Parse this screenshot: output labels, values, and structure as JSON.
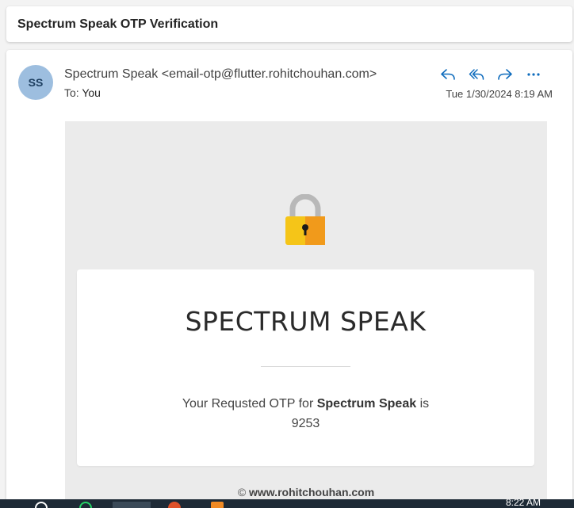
{
  "subject": "Spectrum Speak OTP Verification",
  "header": {
    "avatar_initials": "SS",
    "sender_display": "Spectrum Speak <email-otp@flutter.rohitchouhan.com>",
    "to_prefix": "To:",
    "to_name": "You",
    "date": "Tue 1/30/2024 8:19 AM",
    "actions": [
      "reply-icon",
      "reply-all-icon",
      "forward-icon",
      "more-icon"
    ]
  },
  "body": {
    "brand": "SPECTRUM SPEAK",
    "message_prefix": "Your Requsted OTP for",
    "message_brand": "Spectrum Speak",
    "message_suffix": "is",
    "otp_code": "9253",
    "footer_symbol": "©",
    "footer_site": "www.rohitchouhan.com"
  },
  "taskbar": {
    "clock": "8:22 AM"
  },
  "colors": {
    "avatar_bg": "#9dbedf",
    "action_blue": "#0f6cbd",
    "lock_gold": "#f5c518",
    "lock_orange": "#f19a1b"
  }
}
